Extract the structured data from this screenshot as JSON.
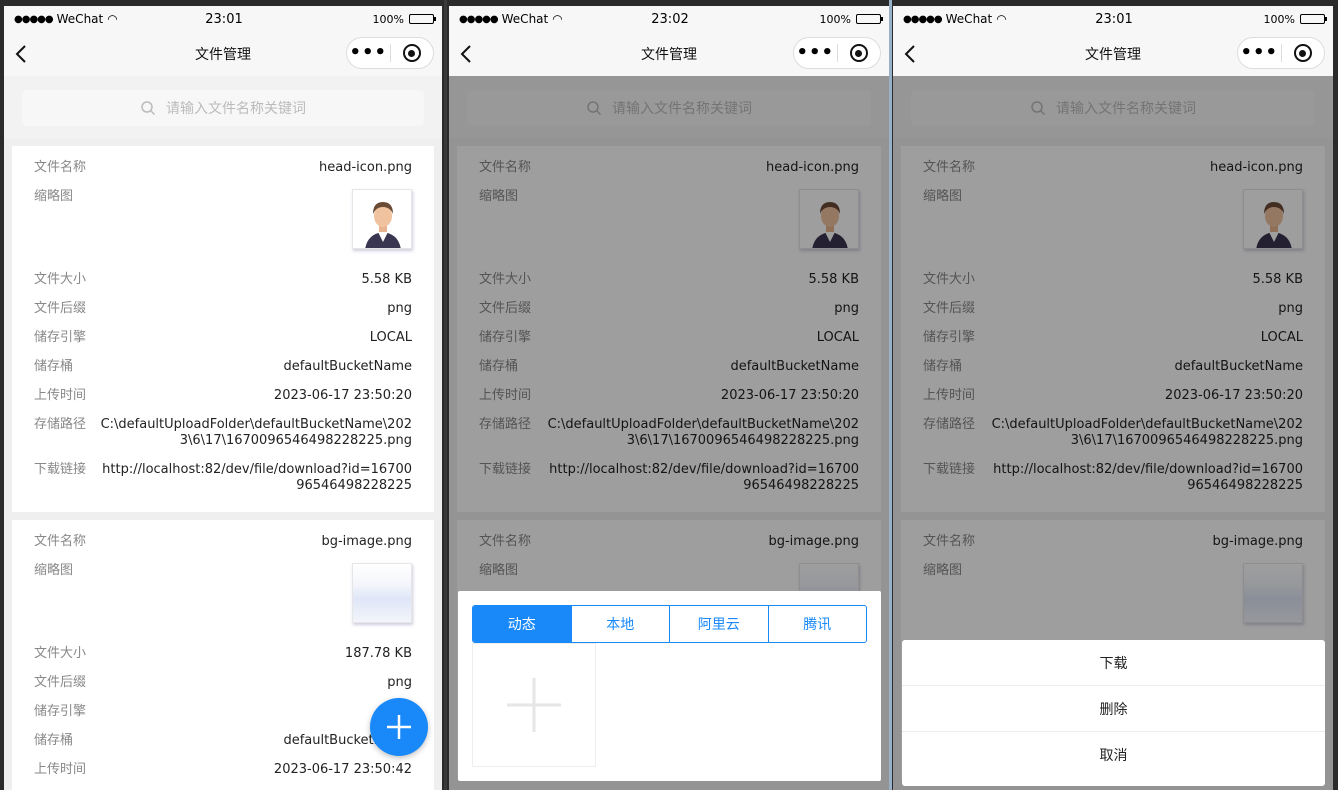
{
  "status": {
    "carrier": "WeChat",
    "battery": "100%"
  },
  "screens": [
    {
      "time": "23:01"
    },
    {
      "time": "23:02"
    },
    {
      "time": "23:01"
    }
  ],
  "nav": {
    "title": "文件管理"
  },
  "search": {
    "placeholder": "请输入文件名称关键词"
  },
  "labels": {
    "name": "文件名称",
    "thumb": "缩略图",
    "size": "文件大小",
    "suffix": "文件后缀",
    "engine": "储存引擎",
    "bucket": "储存桶",
    "upload_time": "上传时间",
    "path": "存储路径",
    "link": "下载链接"
  },
  "files": [
    {
      "name": "head-icon.png",
      "size": "5.58 KB",
      "suffix": "png",
      "engine": "LOCAL",
      "bucket": "defaultBucketName",
      "upload_time": "2023-06-17 23:50:20",
      "path": "C:\\defaultUploadFolder\\defaultBucketName\\2023\\6\\17\\1670096546498228225.png",
      "link": "http://localhost:82/dev/file/download?id=1670096546498228225"
    },
    {
      "name": "bg-image.png",
      "size": "187.78 KB",
      "suffix": "png",
      "engine": "",
      "bucket": "defaultBucketName",
      "upload_time": "2023-06-17 23:50:42"
    }
  ],
  "upload_popup": {
    "tabs": [
      "动态",
      "本地",
      "阿里云",
      "腾讯"
    ]
  },
  "action_sheet": {
    "download": "下载",
    "delete": "删除",
    "cancel": "取消"
  },
  "colors": {
    "accent": "#1989fa"
  }
}
